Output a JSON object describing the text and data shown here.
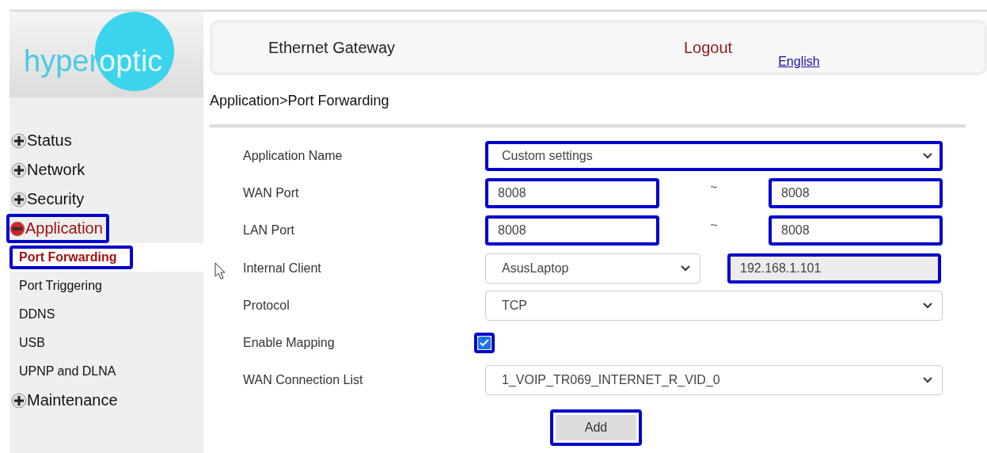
{
  "logo": {
    "part_1": "hyper",
    "part_2": "optic"
  },
  "header": {
    "title": "Ethernet Gateway",
    "logout": "Logout",
    "language": "English"
  },
  "breadcrumb": "Application>Port Forwarding",
  "sidebar": {
    "items": [
      {
        "label": "Status",
        "expanded": false,
        "highlighted": false
      },
      {
        "label": "Network",
        "expanded": false,
        "highlighted": false
      },
      {
        "label": "Security",
        "expanded": false,
        "highlighted": false
      },
      {
        "label": "Application",
        "expanded": true,
        "highlighted": true,
        "children": [
          {
            "label": "Port Forwarding",
            "selected": true,
            "highlighted": true
          },
          {
            "label": "Port Triggering",
            "selected": false,
            "highlighted": false
          },
          {
            "label": "DDNS",
            "selected": false,
            "highlighted": false
          },
          {
            "label": "USB",
            "selected": false,
            "highlighted": false
          },
          {
            "label": "UPNP and DLNA",
            "selected": false,
            "highlighted": false
          }
        ]
      },
      {
        "label": "Maintenance",
        "expanded": false,
        "highlighted": false
      }
    ]
  },
  "form": [
    {
      "kind": "select",
      "label": "Application Name",
      "value": "Custom settings",
      "highlighted": true
    },
    {
      "kind": "range",
      "label": "WAN Port",
      "from": "8008",
      "separator": "~",
      "to": "8008",
      "highlighted": true
    },
    {
      "kind": "range",
      "label": "LAN Port",
      "from": "8008",
      "separator": "~",
      "to": "8008",
      "highlighted": true
    },
    {
      "kind": "client",
      "label": "Internal Client",
      "value": "AsusLaptop",
      "address": "192.168.1.101",
      "highlighted": true
    },
    {
      "kind": "select",
      "label": "Protocol",
      "value": "TCP",
      "highlighted": false
    },
    {
      "kind": "checkbox",
      "label": "Enable Mapping",
      "checked": true,
      "highlighted": true
    },
    {
      "kind": "select",
      "label": "WAN Connection List",
      "value": "1_VOIP_TR069_INTERNET_R_VID_0",
      "highlighted": false
    }
  ],
  "add_button": {
    "label": "Add",
    "highlighted": true
  }
}
